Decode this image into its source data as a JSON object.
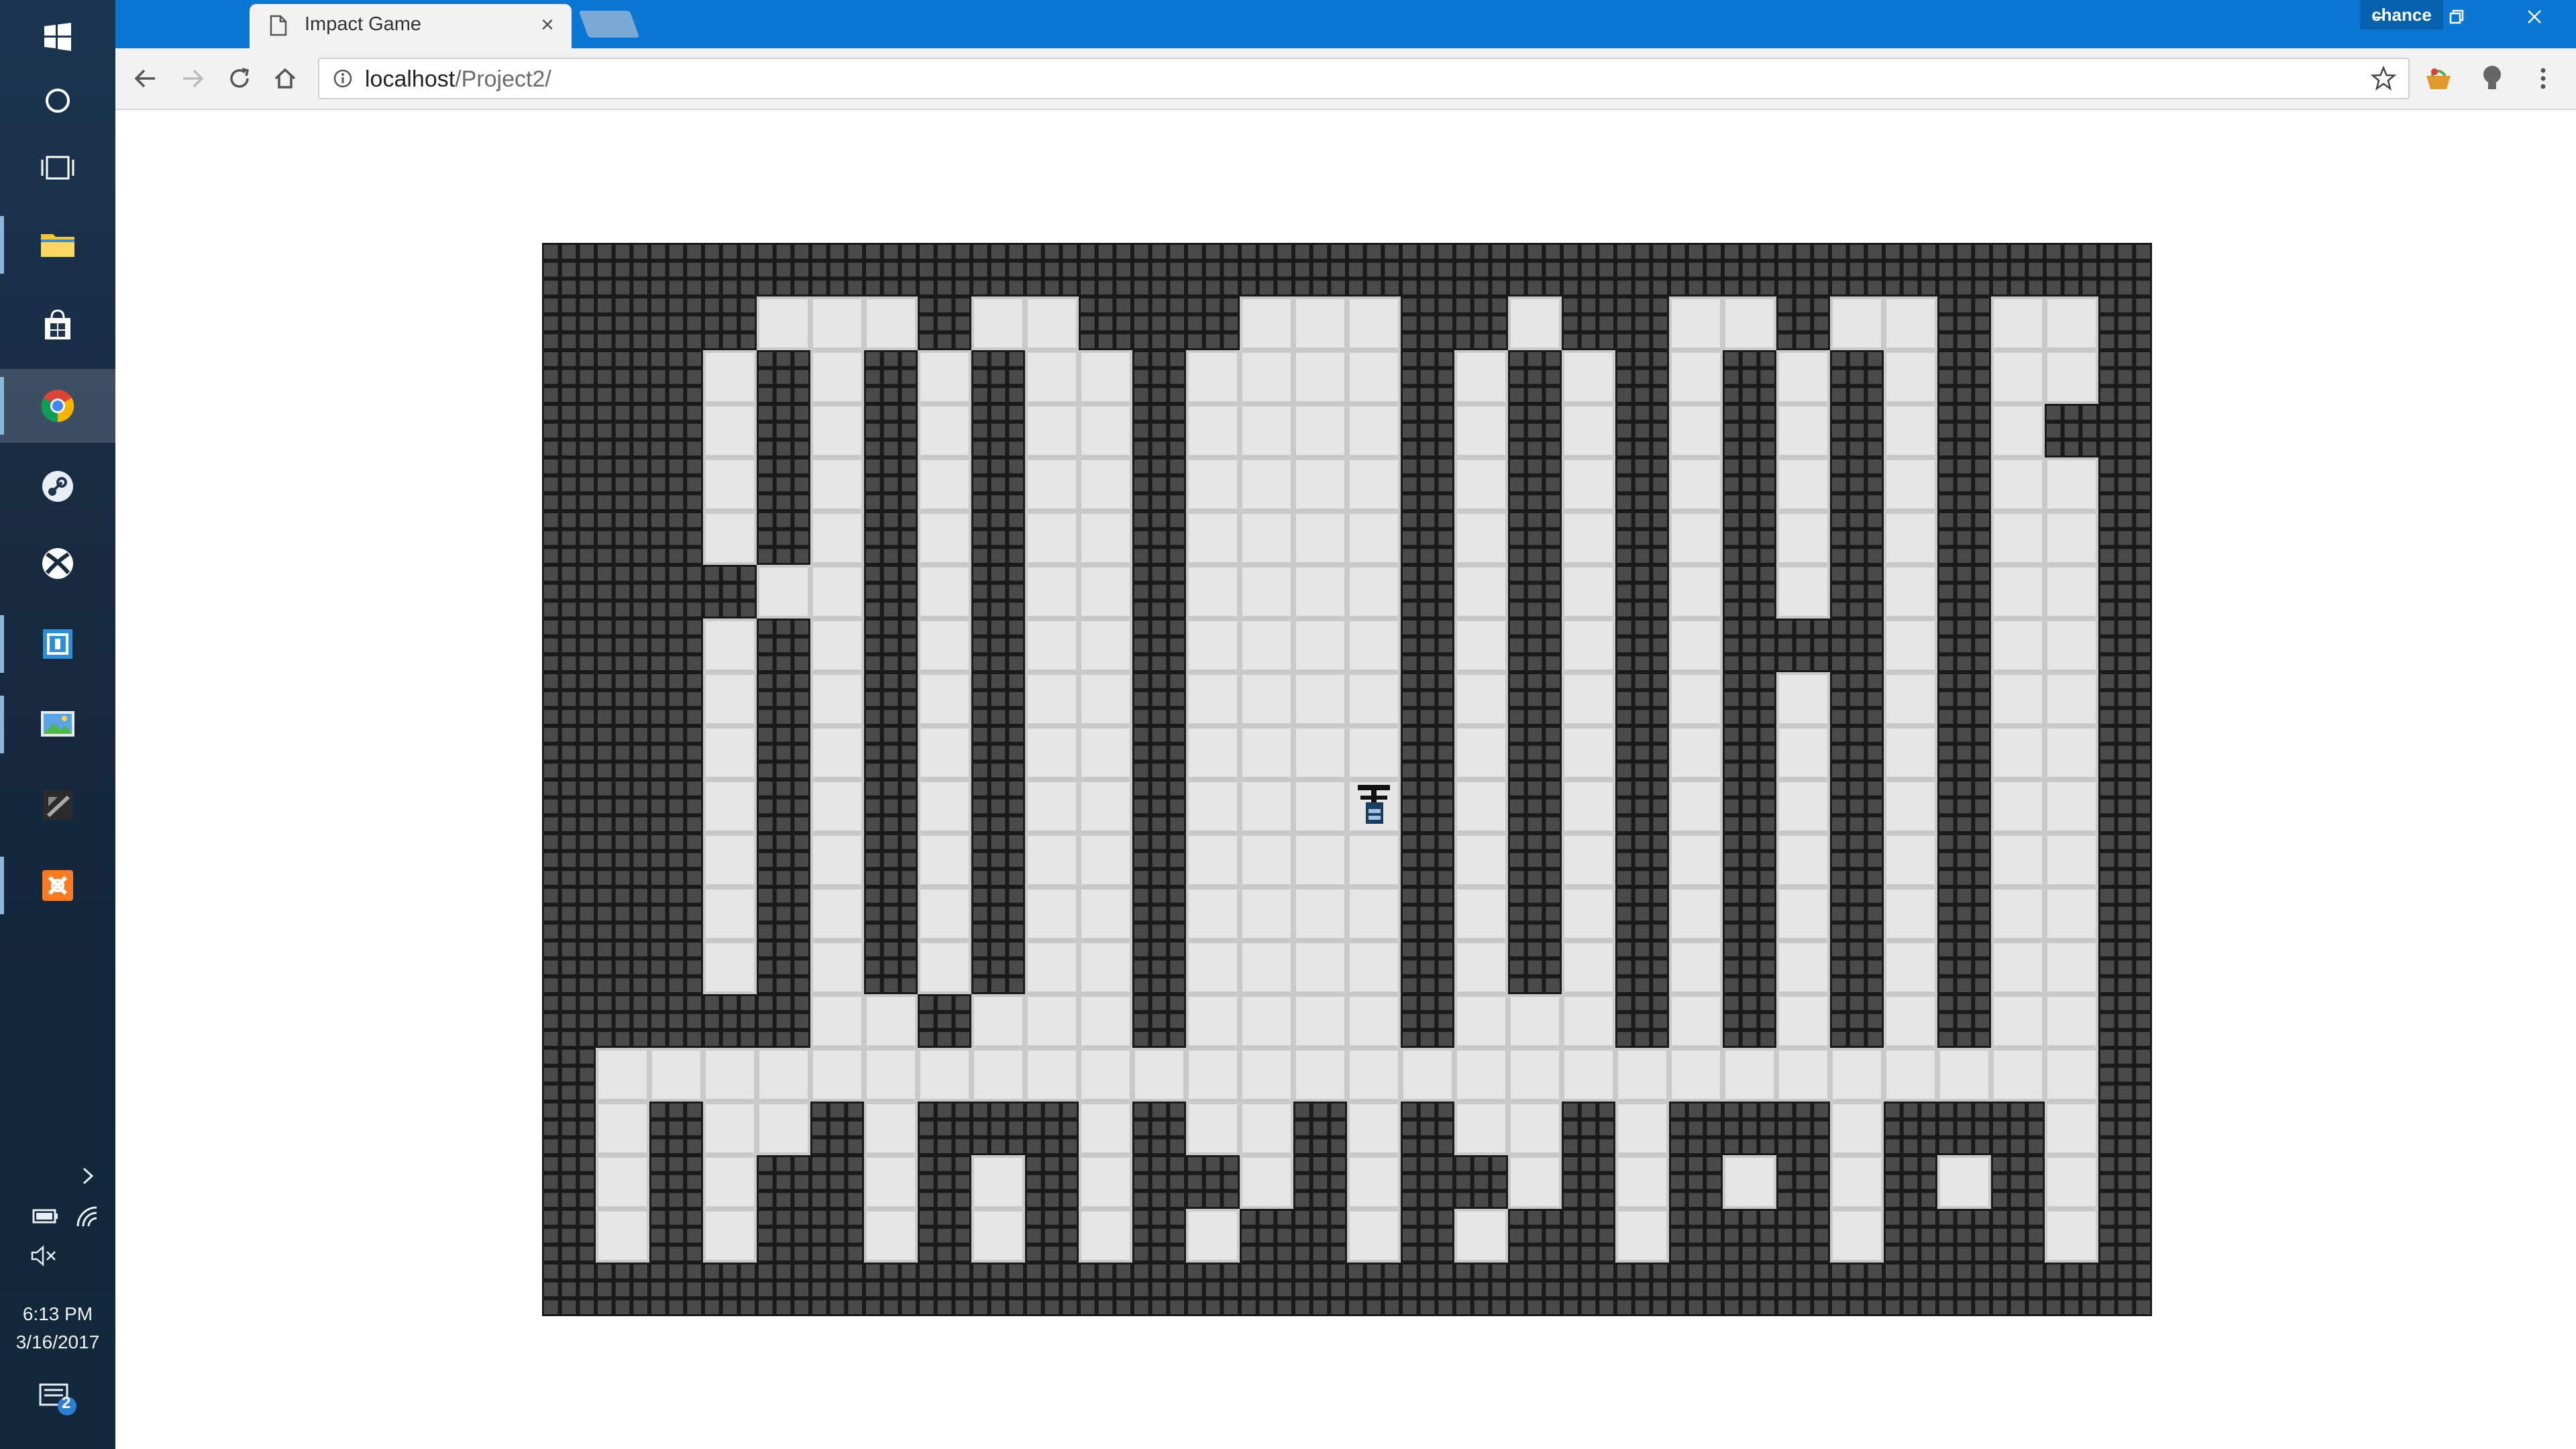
{
  "browser": {
    "tab_title": "Impact Game",
    "url_host": "localhost",
    "url_path": "/Project2/",
    "profile_name": "chance"
  },
  "taskbar": {
    "apps": [
      "windows-start-icon",
      "cortana-icon",
      "task-view-icon",
      "file-explorer-icon",
      "store-icon",
      "chrome-icon",
      "steam-icon",
      "xbox-icon",
      "visual-studio-icon",
      "photos-icon",
      "gpu-tool-icon",
      "xampp-icon"
    ],
    "time": "6:13 PM",
    "date": "3/16/2017",
    "notification_count": "2"
  },
  "game": {
    "tile_size": 40,
    "cols": 30,
    "rows": 20,
    "player_tile": [
      15,
      10
    ],
    "map": [
      "WWWWWWWWWWWWWWWWWWWWWWWWWWWWWW",
      "WWWW...W..WWW...WW.WW..W..W..W",
      "WWW.W.W.W..W....W.W.W.W.W.W..W",
      "WWW.W.W.W..W....W.W.W.W.W.W.WW",
      "WWW.W.W.W..W....W.W.W.W.W.W..W",
      "WWW.W.W.W..W....W.W.W.W.W.W..W",
      "WWWW..W.W..W....W.W.W.W.W.W..W",
      "WWW.W.W.W..W....W.W.W.WWW.W..W",
      "WWW.W.W.W..W....W.W.W.W.W.W..W",
      "WWW.W.W.W..W....W.W.W.W.W.W..W",
      "WWW.W.W.W..W....W.W.W.W.W.W..W",
      "WWW.W.W.W..W....W.W.W.W.W.W..W",
      "WWW.W.W.W..W....W.W.W.W.W.W..W",
      "WWW.W.W.W..W....W.W.W.W.W.W..W",
      "WWWWW..W...W....W...W.W.W.W..W",
      "W............................W",
      "W.W..W.WWW.W..W.W..W.WWW.WWW.W",
      "W.W.WW.W.W.WW.W.WW.W.W.W.W.W.W",
      "W.W.WW.W.W.W.WW.W.WW.WWW.WWW.W",
      "WWWWWWWWWWWWWWWWWWWWWWWWWWWWWW"
    ]
  }
}
